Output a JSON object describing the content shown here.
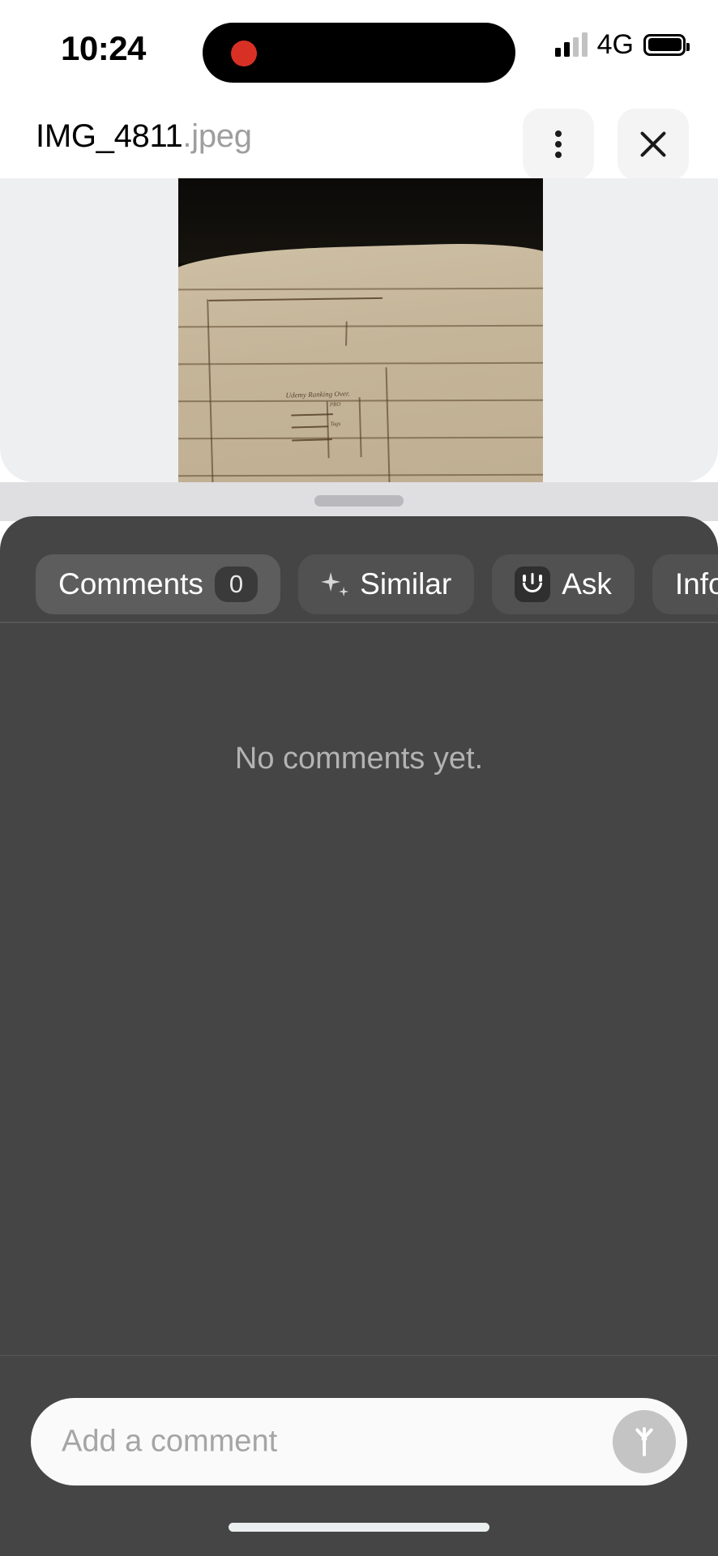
{
  "status_bar": {
    "time": "10:24",
    "network": "4G",
    "recording_indicator": "recording-dot",
    "signal_icon": "signal-bars-icon",
    "battery_icon": "battery-full-icon"
  },
  "header": {
    "file_basename": "IMG_4811",
    "file_extension": ".jpeg",
    "menu_icon": "kebab-menu-icon",
    "close_icon": "close-x-icon"
  },
  "preview": {
    "tag_icon": "tag-icon",
    "grabber": "drag-handle",
    "photo_alt": "photo-of-lined-notebook-paper-sketch",
    "handwriting": [
      "Udemy Ranking Overview",
      "PRO",
      "Tags"
    ]
  },
  "tabs": [
    {
      "label": "Comments",
      "badge": "0",
      "icon": null,
      "active": true
    },
    {
      "label": "Similar",
      "badge": null,
      "icon": "sparkle-icon",
      "active": false
    },
    {
      "label": "Ask",
      "badge": null,
      "icon": "smiley-face-icon",
      "active": false
    },
    {
      "label": "Info",
      "badge": null,
      "icon": null,
      "active": false
    }
  ],
  "content": {
    "empty_message": "No comments yet."
  },
  "composer": {
    "placeholder": "Add a comment",
    "send_icon": "arrow-up-icon"
  },
  "colors": {
    "sheet_background": "#454545",
    "tab_active": "#5d5d5d",
    "tab_inactive": "#515151",
    "recording_dot": "#d93025",
    "panel_background": "#eeeff1",
    "header_button": "#f4f4f5"
  }
}
